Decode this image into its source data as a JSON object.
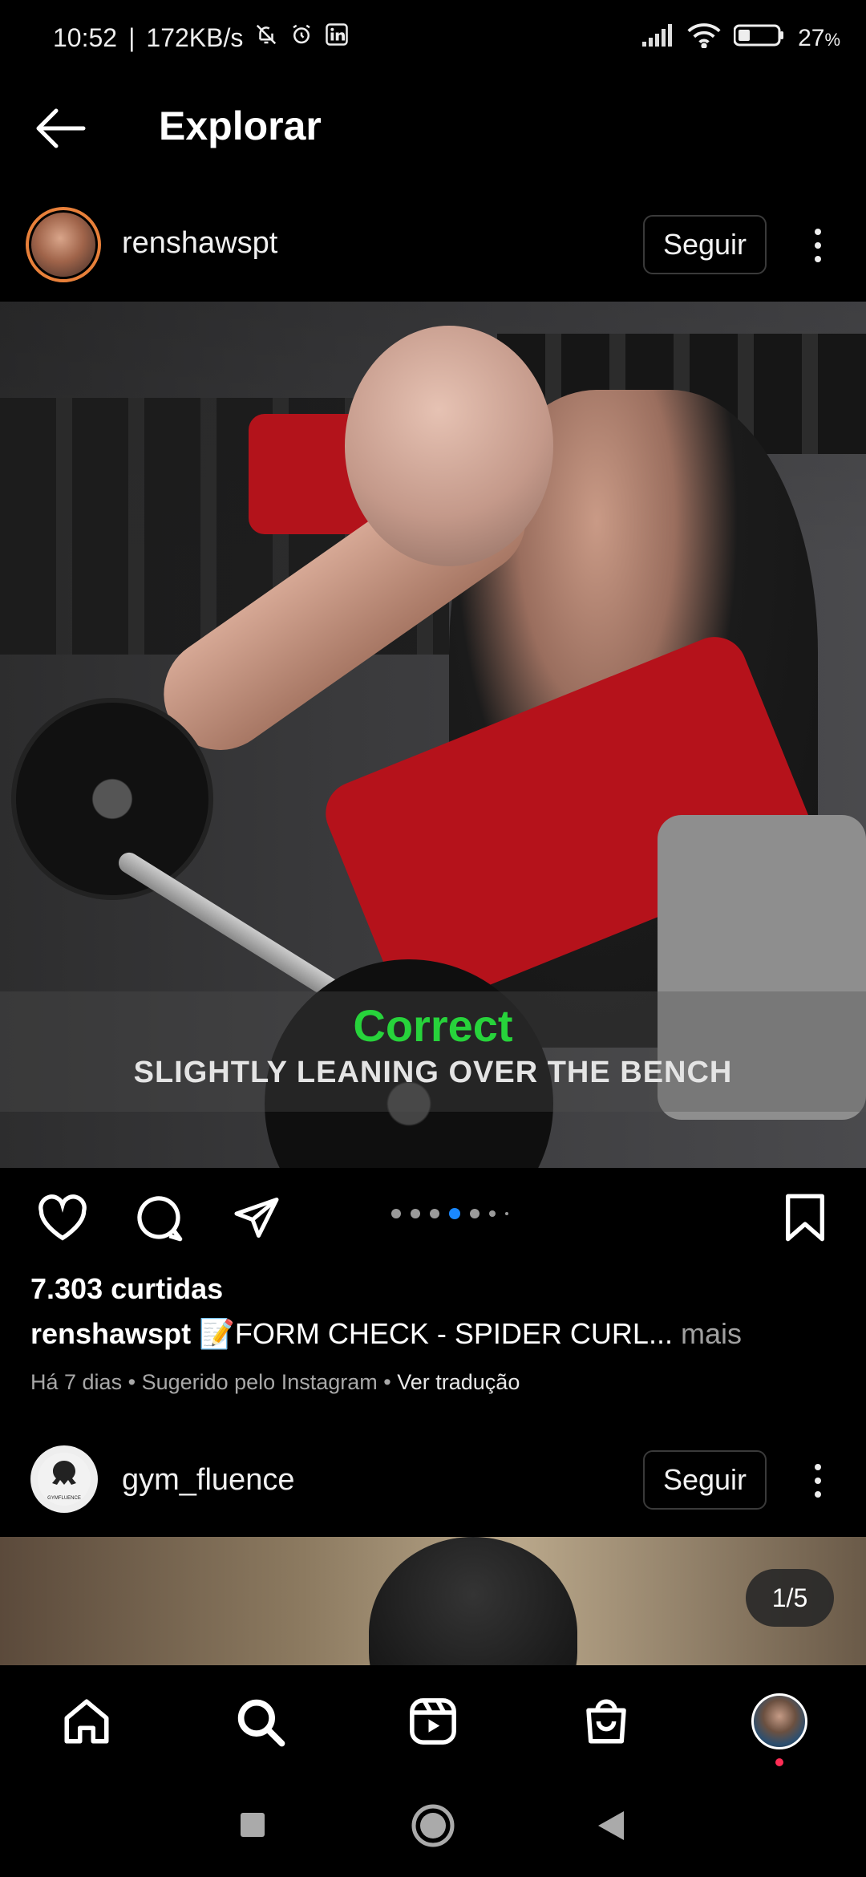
{
  "status_bar": {
    "time": "10:52",
    "speed": "172KB/s",
    "battery": "27",
    "battery_unit": "%"
  },
  "header": {
    "title": "Explorar",
    "back_icon": "arrow-left-icon"
  },
  "post1": {
    "username": "renshawspt",
    "follow_label": "Seguir",
    "overlay_line1": "Correct",
    "overlay_line2": "SLIGHTLY LEANING OVER THE BENCH",
    "likes": "7.303 curtidas",
    "caption_user": "renshawspt",
    "caption_text": "📝FORM CHECK - SPIDER CURL...",
    "caption_more": "mais",
    "meta_time": "Há 7 dias",
    "meta_sep1": "•",
    "meta_suggested": "Sugerido pelo Instagram",
    "meta_sep2": "•",
    "meta_translate": "Ver tradução",
    "carousel_active_index": 3,
    "carousel_total_dots": 6
  },
  "post2": {
    "username": "gym_fluence",
    "follow_label": "Seguir",
    "avatar_text": "GYMFLUENCE",
    "counter": "1/5"
  },
  "bottom_nav": {
    "items": [
      "home-icon",
      "search-icon",
      "reels-icon",
      "shop-icon",
      "profile-avatar"
    ]
  },
  "colors": {
    "background": "#000000",
    "active_dot": "#1a88ff",
    "notification": "#ff2d55",
    "overlay_green": "#27d33b",
    "story_ring": "#e8803a"
  }
}
